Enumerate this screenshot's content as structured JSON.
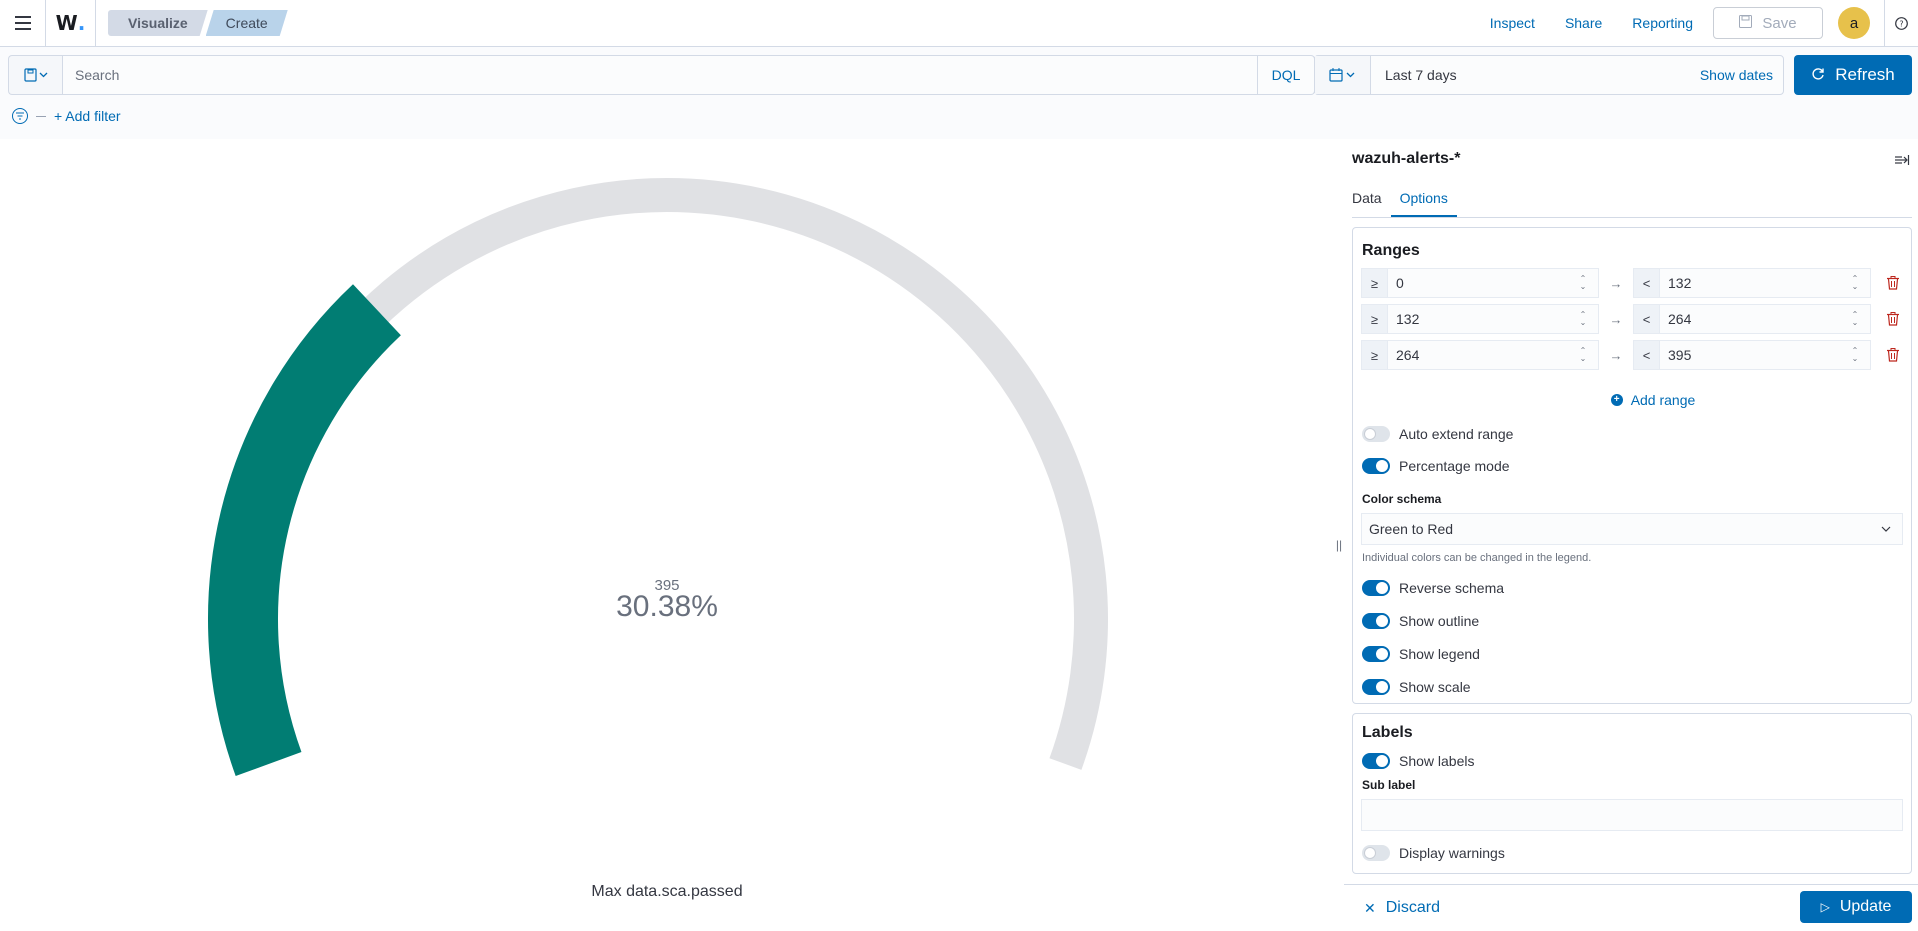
{
  "header": {
    "breadcrumbs": [
      "Visualize",
      "Create"
    ],
    "links": {
      "inspect": "Inspect",
      "share": "Share",
      "reporting": "Reporting"
    },
    "save_label": "Save",
    "avatar_initial": "a"
  },
  "querybar": {
    "search_placeholder": "Search",
    "language": "DQL",
    "date_range": "Last 7 days",
    "show_dates": "Show dates",
    "refresh_label": "Refresh",
    "add_filter": "+ Add filter"
  },
  "gauge": {
    "value": 120,
    "max": 395,
    "max_label": "395",
    "percent_label": "30.38%",
    "metric_label": "Max data.sca.passed",
    "fill_color": "#017d73",
    "track_color": "#e0e1e4"
  },
  "sidebar": {
    "index_pattern": "wazuh-alerts-*",
    "tabs": [
      "Data",
      "Options"
    ],
    "active_tab": "Options",
    "ranges": {
      "title": "Ranges",
      "rows": [
        {
          "from_prefix": "≥",
          "from": "0",
          "to_prefix": "<",
          "to": "132"
        },
        {
          "from_prefix": "≥",
          "from": "132",
          "to_prefix": "<",
          "to": "264"
        },
        {
          "from_prefix": "≥",
          "from": "264",
          "to_prefix": "<",
          "to": "395"
        }
      ],
      "add_range": "Add range",
      "auto_extend": "Auto extend range",
      "percentage_mode": "Percentage mode",
      "color_schema_label": "Color schema",
      "color_schema_value": "Green to Red",
      "color_help": "Individual colors can be changed in the legend.",
      "reverse_schema": "Reverse schema",
      "show_outline": "Show outline",
      "show_legend": "Show legend",
      "show_scale": "Show scale"
    },
    "labels": {
      "title": "Labels",
      "show_labels": "Show labels",
      "sub_label": "Sub label",
      "sub_label_value": "",
      "display_warnings": "Display warnings"
    }
  },
  "footer": {
    "discard": "Discard",
    "update": "Update"
  }
}
